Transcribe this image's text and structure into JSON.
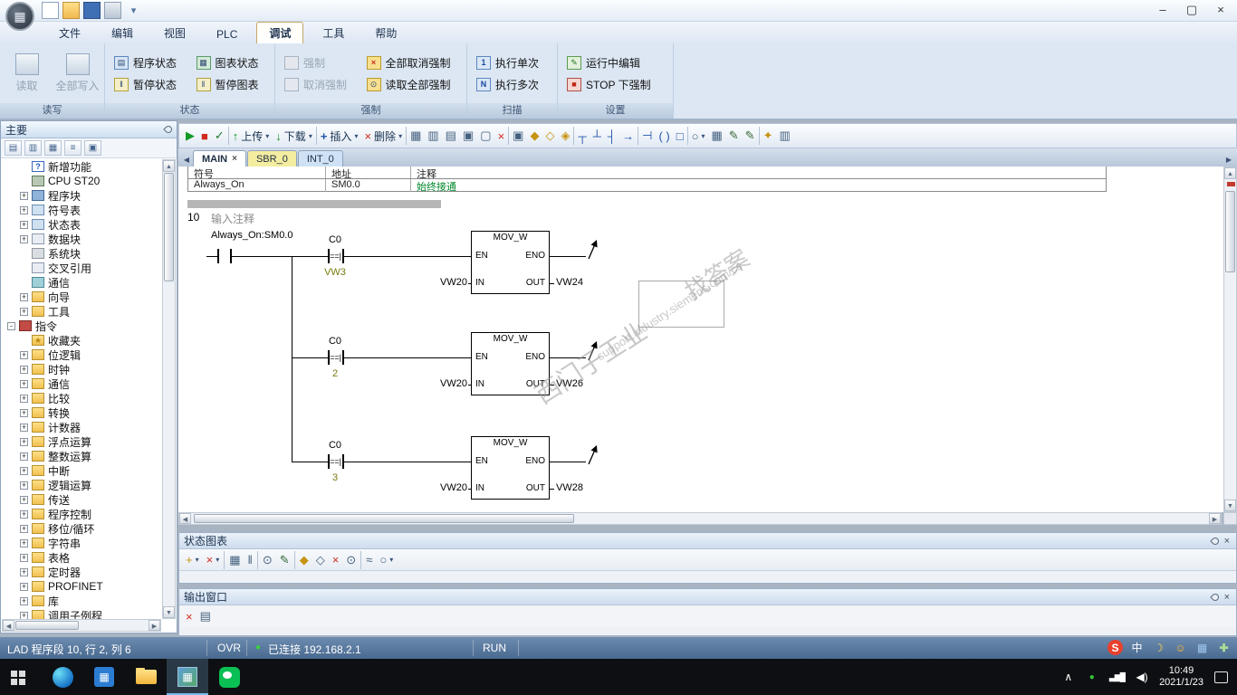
{
  "colors": {
    "statusbar": "#52749b",
    "taskbar": "#0d0f12",
    "tab_sbr": "#f4eda0",
    "tab_int": "#cfe2f5",
    "connected_dot": "#3ad23a",
    "comment_green": "#00882a",
    "ribbon_bg": "#dce7f3"
  },
  "titlebar": {
    "app_glyph": "▦",
    "quick_icons": [
      {
        "name": "new-file-icon",
        "g": ""
      },
      {
        "name": "open-project-icon",
        "g": ""
      },
      {
        "name": "save-icon",
        "g": ""
      },
      {
        "name": "print-icon",
        "g": ""
      },
      {
        "name": "customize-quick-access-icon",
        "g": "▾"
      }
    ],
    "window_controls": [
      {
        "name": "minimize-button",
        "g": "–"
      },
      {
        "name": "maximize-button",
        "g": "▢"
      },
      {
        "name": "close-button",
        "g": "×"
      }
    ]
  },
  "menubar": {
    "items": [
      {
        "label": "文件",
        "name": "menu-file"
      },
      {
        "label": "编辑",
        "name": "menu-edit"
      },
      {
        "label": "视图",
        "name": "menu-view"
      },
      {
        "label": "PLC",
        "name": "menu-plc"
      },
      {
        "label": "调试",
        "name": "menu-debug",
        "active": "true"
      },
      {
        "label": "工具",
        "name": "menu-tools"
      },
      {
        "label": "帮助",
        "name": "menu-help"
      }
    ]
  },
  "ribbon": {
    "groups": [
      {
        "label": "读写",
        "buttons": [
          {
            "label": "读取",
            "name": "read-button",
            "disabled": "true"
          },
          {
            "label": "全部写入",
            "name": "write-all-button",
            "disabled": "true"
          }
        ]
      },
      {
        "label": "状态",
        "buttons": [
          {
            "label": "程序状态",
            "name": "program-status-button",
            "g": "▤"
          },
          {
            "label": "暂停状态",
            "name": "pause-status-button",
            "g": "‖"
          },
          {
            "label": "图表状态",
            "name": "chart-status-button",
            "g": "▦"
          },
          {
            "label": "暂停图表",
            "name": "pause-chart-button",
            "g": "‖"
          }
        ]
      },
      {
        "label": "强制",
        "buttons": [
          {
            "label": "强制",
            "name": "force-button",
            "disabled": "true",
            "g": ""
          },
          {
            "label": "取消强制",
            "name": "unforce-button",
            "disabled": "true",
            "g": ""
          },
          {
            "label": "全部取消强制",
            "name": "unforce-all-button",
            "g": "×"
          },
          {
            "label": "读取全部强制",
            "name": "read-all-forced-button",
            "g": "⊙"
          }
        ]
      },
      {
        "label": "扫描",
        "buttons": [
          {
            "label": "执行单次",
            "name": "execute-single-button",
            "g": "1"
          },
          {
            "label": "执行多次",
            "name": "execute-multiple-button",
            "g": "N"
          }
        ]
      },
      {
        "label": "设置",
        "buttons": [
          {
            "label": "运行中编辑",
            "name": "edit-in-run-button",
            "g": "✎"
          },
          {
            "label": "STOP 下强制",
            "name": "force-in-stop-button",
            "g": "■"
          }
        ]
      }
    ]
  },
  "sidebar": {
    "title": "主要",
    "view_icons": [
      {
        "name": "tree-view-icon",
        "g": "▤"
      },
      {
        "name": "list-view-icon",
        "g": "▥"
      },
      {
        "name": "detail-view-icon",
        "g": "▦"
      },
      {
        "name": "favorites-view-icon",
        "g": "≡"
      },
      {
        "name": "columns-view-icon",
        "g": "▣"
      }
    ],
    "tree": [
      {
        "label": "新增功能",
        "icon": "new-features-icon",
        "g": "?",
        "exp": "",
        "level": "1"
      },
      {
        "label": "CPU ST20",
        "icon": "cpu-icon",
        "g": "",
        "exp": "",
        "level": "1"
      },
      {
        "label": "程序块",
        "icon": "program-block-icon",
        "g": "",
        "exp": "+",
        "level": "1"
      },
      {
        "label": "符号表",
        "icon": "symbol-table-tree-icon",
        "g": "",
        "exp": "+",
        "level": "1"
      },
      {
        "label": "状态表",
        "icon": "status-table-tree-icon",
        "g": "",
        "exp": "+",
        "level": "1"
      },
      {
        "label": "数据块",
        "icon": "data-block-tree-icon",
        "g": "",
        "exp": "+",
        "level": "1"
      },
      {
        "label": "系统块",
        "icon": "system-block-icon",
        "g": "",
        "exp": "",
        "level": "1"
      },
      {
        "label": "交叉引用",
        "icon": "cross-reference-icon",
        "g": "",
        "exp": "",
        "level": "1"
      },
      {
        "label": "通信",
        "icon": "communication-icon",
        "g": "",
        "exp": "",
        "level": "1"
      },
      {
        "label": "向导",
        "icon": "wizard-icon",
        "g": "",
        "exp": "+",
        "level": "1"
      },
      {
        "label": "工具",
        "icon": "tools-icon",
        "g": "",
        "exp": "+",
        "level": "1"
      },
      {
        "label": "指令",
        "icon": "instructions-icon",
        "g": "",
        "exp": "-",
        "level": "0"
      },
      {
        "label": "收藏夹",
        "icon": "favorites-icon",
        "g": "★",
        "exp": "",
        "level": "1"
      },
      {
        "label": "位逻辑",
        "icon": "bit-logic-icon",
        "g": "",
        "exp": "+",
        "level": "1"
      },
      {
        "label": "时钟",
        "icon": "clock-icon",
        "g": "",
        "exp": "+",
        "level": "1"
      },
      {
        "label": "通信",
        "icon": "comm-instructions-icon",
        "g": "",
        "exp": "+",
        "level": "1"
      },
      {
        "label": "比较",
        "icon": "compare-icon",
        "g": "",
        "exp": "+",
        "level": "1"
      },
      {
        "label": "转换",
        "icon": "convert-icon",
        "g": "",
        "exp": "+",
        "level": "1"
      },
      {
        "label": "计数器",
        "icon": "counters-icon",
        "g": "",
        "exp": "+",
        "level": "1"
      },
      {
        "label": "浮点运算",
        "icon": "float-math-icon",
        "g": "",
        "exp": "+",
        "level": "1"
      },
      {
        "label": "整数运算",
        "icon": "integer-math-icon",
        "g": "",
        "exp": "+",
        "level": "1"
      },
      {
        "label": "中断",
        "icon": "interrupt-icon",
        "g": "",
        "exp": "+",
        "level": "1"
      },
      {
        "label": "逻辑运算",
        "icon": "logic-ops-icon",
        "g": "",
        "exp": "+",
        "level": "1"
      },
      {
        "label": "传送",
        "icon": "move-icon",
        "g": "",
        "exp": "+",
        "level": "1"
      },
      {
        "label": "程序控制",
        "icon": "program-control-icon",
        "g": "",
        "exp": "+",
        "level": "1"
      },
      {
        "label": "移位/循环",
        "icon": "shift-rotate-icon",
        "g": "",
        "exp": "+",
        "level": "1"
      },
      {
        "label": "字符串",
        "icon": "string-icon",
        "g": "",
        "exp": "+",
        "level": "1"
      },
      {
        "label": "表格",
        "icon": "table-icon",
        "g": "",
        "exp": "+",
        "level": "1"
      },
      {
        "label": "定时器",
        "icon": "timers-icon",
        "g": "",
        "exp": "+",
        "level": "1"
      },
      {
        "label": "PROFINET",
        "icon": "profinet-icon",
        "g": "",
        "exp": "+",
        "level": "1"
      },
      {
        "label": "库",
        "icon": "library-icon",
        "g": "",
        "exp": "+",
        "level": "1"
      },
      {
        "label": "调用子例程",
        "icon": "call-subroutine-icon",
        "g": "",
        "exp": "+",
        "level": "1"
      }
    ]
  },
  "editor": {
    "toolbar": [
      {
        "name": "run-button",
        "g": "▶"
      },
      {
        "name": "stop-button",
        "g": "■"
      },
      {
        "name": "compile-button",
        "g": "✓"
      },
      {
        "name": "separator"
      },
      {
        "name": "upload-button",
        "g": "↑",
        "label": "上传",
        "dd": "▾"
      },
      {
        "name": "download-button",
        "g": "↓",
        "label": "下载",
        "dd": "▾"
      },
      {
        "name": "separator"
      },
      {
        "name": "insert-button",
        "g": "+",
        "label": "插入",
        "dd": "▾"
      },
      {
        "name": "delete-button",
        "g": "×",
        "label": "删除",
        "dd": "▾"
      },
      {
        "name": "separator"
      },
      {
        "name": "symbol-table-button",
        "g": "▦"
      },
      {
        "name": "status-chart-button",
        "g": "▥"
      },
      {
        "name": "data-block-button",
        "g": "▤"
      },
      {
        "name": "open-folder-button",
        "g": "▣"
      },
      {
        "name": "save-project-button",
        "g": "▢"
      },
      {
        "name": "close-editor-button",
        "g": "×"
      },
      {
        "name": "separator"
      },
      {
        "name": "go-to-pou-button",
        "g": "▣"
      },
      {
        "name": "lock-button",
        "g": "◆"
      },
      {
        "name": "unlock-button",
        "g": "◇"
      },
      {
        "name": "protect-button",
        "g": "◈"
      },
      {
        "name": "separator"
      },
      {
        "name": "line-down-button",
        "g": "┬"
      },
      {
        "name": "line-up-button",
        "g": "┴"
      },
      {
        "name": "line-left-button",
        "g": "┤"
      },
      {
        "name": "line-right-button",
        "g": "→"
      },
      {
        "name": "separator"
      },
      {
        "name": "insert-contact-button",
        "g": "⊣"
      },
      {
        "name": "insert-coil-button",
        "g": "( )"
      },
      {
        "name": "insert-box-button",
        "g": "□"
      },
      {
        "name": "separator"
      },
      {
        "name": "comment-button",
        "g": "○",
        "dd": "▾"
      },
      {
        "name": "address-view-button",
        "g": "▦"
      },
      {
        "name": "edit-symbols-button",
        "g": "✎"
      },
      {
        "name": "edit-status-button",
        "g": "✎"
      },
      {
        "name": "separator"
      },
      {
        "name": "key-button",
        "g": "✦"
      },
      {
        "name": "library-button",
        "g": "▥"
      }
    ],
    "tabs": [
      {
        "label": "MAIN",
        "name": "tab-main",
        "state": "active",
        "close": "×"
      },
      {
        "label": "SBR_0",
        "name": "tab-sbr0",
        "state": "sbr",
        "close": ""
      },
      {
        "label": "INT_0",
        "name": "tab-int0",
        "state": "int",
        "close": ""
      }
    ],
    "symbol_table": {
      "headers": {
        "symbol": "符号",
        "address": "地址",
        "comment": "注释"
      },
      "row": {
        "symbol": "Always_On",
        "address": "SM0.0",
        "comment": "始终接通"
      }
    },
    "network": {
      "number": "10",
      "title": "输入注释",
      "contact_label": "Always_On:SM0.0",
      "rungs": [
        {
          "idx": "0",
          "cmp_in1": "C0",
          "cmp_op": "==|",
          "cmp_in2": "VW3",
          "block": "MOV_W",
          "en": "EN",
          "eno": "ENO",
          "in": "IN",
          "out": "OUT",
          "in_operand": "VW20",
          "out_operand": "VW24"
        },
        {
          "idx": "1",
          "cmp_in1": "C0",
          "cmp_op": "==|",
          "cmp_in2": "2",
          "block": "MOV_W",
          "en": "EN",
          "eno": "ENO",
          "in": "IN",
          "out": "OUT",
          "in_operand": "VW20",
          "out_operand": "VW26"
        },
        {
          "idx": "2",
          "cmp_in1": "C0",
          "cmp_op": "==|",
          "cmp_in2": "3",
          "block": "MOV_W",
          "en": "EN",
          "eno": "ENO",
          "in": "IN",
          "out": "OUT",
          "in_operand": "VW20",
          "out_operand": "VW28"
        }
      ]
    },
    "watermark": {
      "line1": "找答案",
      "line2": "support.industry.siemens.com/cs",
      "line3": "西门子工业"
    }
  },
  "status_chart_panel": {
    "title": "状态图表",
    "toolbar": [
      {
        "name": "add-chart-button",
        "g": "+",
        "dd": "▾"
      },
      {
        "name": "delete-chart-button",
        "g": "×",
        "dd": "▾"
      },
      {
        "name": "separator"
      },
      {
        "name": "chart-status-toggle-icon",
        "g": "▦"
      },
      {
        "name": "pause-chart-toggle-icon",
        "g": "‖"
      },
      {
        "name": "separator"
      },
      {
        "name": "read-values-icon",
        "g": "⊙"
      },
      {
        "name": "write-values-icon",
        "g": "✎"
      },
      {
        "name": "separator"
      },
      {
        "name": "force-value-icon",
        "g": "◆"
      },
      {
        "name": "unforce-value-icon",
        "g": "◇"
      },
      {
        "name": "unforce-all-values-icon",
        "g": "×"
      },
      {
        "name": "read-forced-icon",
        "g": "⊙"
      },
      {
        "name": "separator"
      },
      {
        "name": "trend-view-icon",
        "g": "≈"
      },
      {
        "name": "chart-comment-icon",
        "g": "○",
        "dd": "▾"
      }
    ]
  },
  "output_panel": {
    "title": "输出窗口",
    "toolbar": [
      {
        "name": "clear-output-icon",
        "g": "×"
      },
      {
        "name": "output-page-icon",
        "g": "▤"
      }
    ]
  },
  "statusbar": {
    "position": "LAD 程序段 10, 行 2, 列 6",
    "ovr": "OVR",
    "connected_dot": "●",
    "connection": "已连接 192.168.2.1",
    "mode": "RUN",
    "ime_icons": [
      {
        "name": "sogou-logo-icon",
        "g": "S"
      },
      {
        "name": "ime-mode-icon",
        "g": "中"
      },
      {
        "name": "ime-moon-icon",
        "g": "☽"
      },
      {
        "name": "ime-emoji-icon",
        "g": "☺"
      },
      {
        "name": "ime-skin-icon",
        "g": "▦"
      },
      {
        "name": "ime-toolbox-icon",
        "g": "✚"
      }
    ]
  },
  "taskbar": {
    "apps": [
      {
        "name": "start-button",
        "g": "",
        "active": "false"
      },
      {
        "name": "edge-icon",
        "g": "",
        "active": "false"
      },
      {
        "name": "store-app-icon",
        "g": "▦",
        "active": "false"
      },
      {
        "name": "file-explorer-icon",
        "g": "",
        "active": "false"
      },
      {
        "name": "microwin-app-icon",
        "g": "▦",
        "active": "true"
      },
      {
        "name": "wechat-icon",
        "g": "",
        "active": "false"
      }
    ],
    "tray": [
      {
        "name": "tray-expand-icon",
        "g": "∧"
      },
      {
        "name": "tray-status-icon",
        "g": "●"
      },
      {
        "name": "network-icon",
        "g": "▃▆█"
      },
      {
        "name": "volume-icon",
        "g": "◀)"
      }
    ],
    "clock": {
      "time": "10:49",
      "date": "2021/1/23"
    }
  }
}
